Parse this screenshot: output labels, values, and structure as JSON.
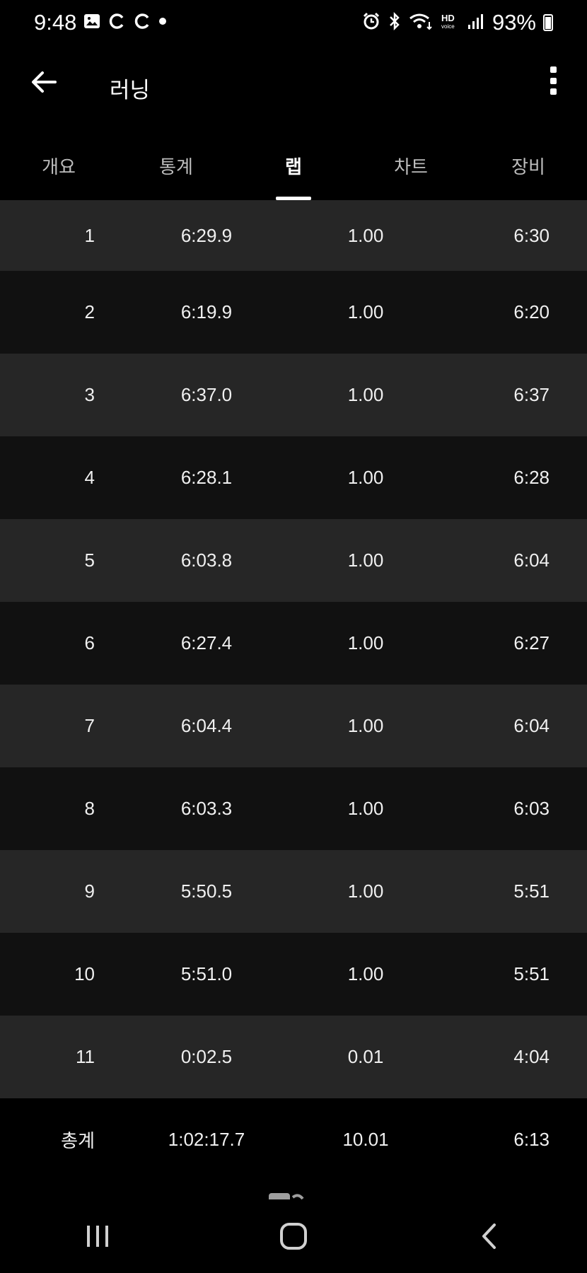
{
  "status_bar": {
    "time": "9:48",
    "battery": "93%",
    "icons_left": [
      "image-icon",
      "sync-icon",
      "sync-icon",
      "dot-icon"
    ],
    "icons_right": [
      "alarm-icon",
      "bluetooth-icon",
      "wifi-icon",
      "hd-voice-icon",
      "signal-icon",
      "battery-icon"
    ]
  },
  "app_bar": {
    "title": "러닝"
  },
  "tabs": [
    {
      "label": "개요",
      "active": false
    },
    {
      "label": "통계",
      "active": false
    },
    {
      "label": "랩",
      "active": true
    },
    {
      "label": "차트",
      "active": false
    },
    {
      "label": "장비",
      "active": false
    }
  ],
  "laps": [
    {
      "lap": "1",
      "time": "6:29.9",
      "distance": "1.00",
      "pace": "6:30"
    },
    {
      "lap": "2",
      "time": "6:19.9",
      "distance": "1.00",
      "pace": "6:20"
    },
    {
      "lap": "3",
      "time": "6:37.0",
      "distance": "1.00",
      "pace": "6:37"
    },
    {
      "lap": "4",
      "time": "6:28.1",
      "distance": "1.00",
      "pace": "6:28"
    },
    {
      "lap": "5",
      "time": "6:03.8",
      "distance": "1.00",
      "pace": "6:04"
    },
    {
      "lap": "6",
      "time": "6:27.4",
      "distance": "1.00",
      "pace": "6:27"
    },
    {
      "lap": "7",
      "time": "6:04.4",
      "distance": "1.00",
      "pace": "6:04"
    },
    {
      "lap": "8",
      "time": "6:03.3",
      "distance": "1.00",
      "pace": "6:03"
    },
    {
      "lap": "9",
      "time": "5:50.5",
      "distance": "1.00",
      "pace": "5:51"
    },
    {
      "lap": "10",
      "time": "5:51.0",
      "distance": "1.00",
      "pace": "5:51"
    },
    {
      "lap": "11",
      "time": "0:02.5",
      "distance": "0.01",
      "pace": "4:04"
    }
  ],
  "total": {
    "lap": "총계",
    "time": "1:02:17.7",
    "distance": "10.01",
    "pace": "6:13"
  },
  "colors": {
    "background": "#000000",
    "row_odd": "#262626",
    "row_even": "#111111",
    "text": "#ffffff",
    "tab_inactive": "#bdbdbd"
  }
}
